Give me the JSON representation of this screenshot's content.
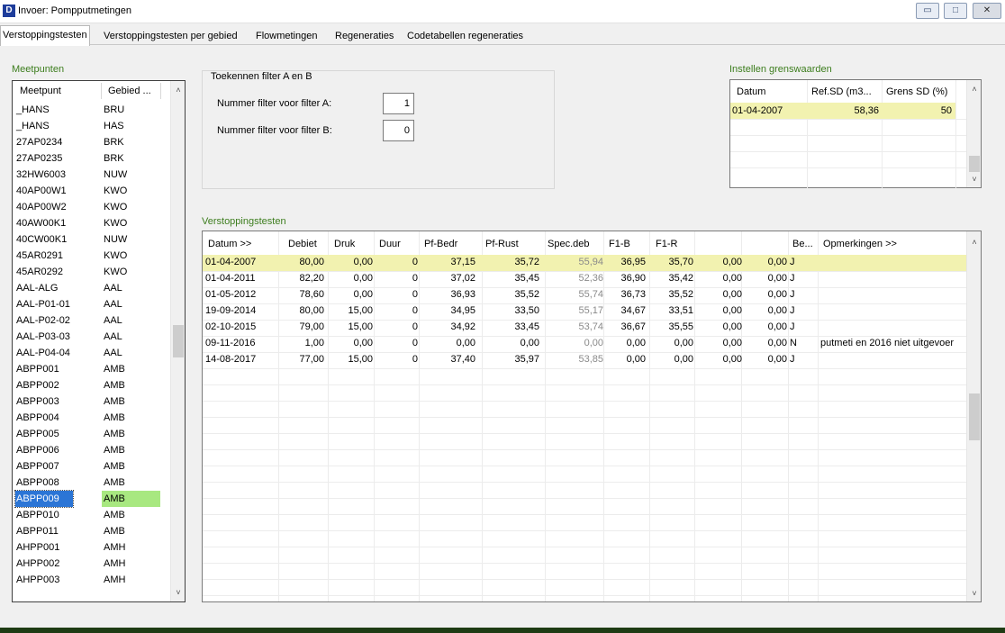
{
  "window": {
    "title": "Invoer: Pompputmetingen",
    "icon_letter": "D",
    "minimize_glyph": "▭",
    "maximize_glyph": "□",
    "close_glyph": "✕"
  },
  "tabs": [
    {
      "label": "Verstoppingstesten",
      "active": true
    },
    {
      "label": "Verstoppingstesten per gebied"
    },
    {
      "label": "Flowmetingen"
    },
    {
      "label": "Regeneraties"
    },
    {
      "label": "Codetabellen regeneraties"
    }
  ],
  "meetpunten": {
    "label": "Meetpunten",
    "columns": [
      "Meetpunt",
      "Gebied ..."
    ],
    "selected_index": 29,
    "rows": [
      [
        "_HANS",
        "BRU"
      ],
      [
        "_HANS",
        "HAS"
      ],
      [
        "27AP0234",
        "BRK"
      ],
      [
        "27AP0235",
        "BRK"
      ],
      [
        "32HW6003",
        "NUW"
      ],
      [
        "40AP00W1",
        "KWO"
      ],
      [
        "40AP00W2",
        "KWO"
      ],
      [
        "40AW00K1",
        "KWO"
      ],
      [
        "40CW00K1",
        "NUW"
      ],
      [
        "45AR0291",
        "KWO"
      ],
      [
        "45AR0292",
        "KWO"
      ],
      [
        "AAL-ALG",
        "AAL"
      ],
      [
        "AAL-P01-01",
        "AAL"
      ],
      [
        "AAL-P02-02",
        "AAL"
      ],
      [
        "AAL-P03-03",
        "AAL"
      ],
      [
        "AAL-P04-04",
        "AAL"
      ],
      [
        "ABPP001",
        "AMB"
      ],
      [
        "ABPP002",
        "AMB"
      ],
      [
        "ABPP003",
        "AMB"
      ],
      [
        "ABPP004",
        "AMB"
      ],
      [
        "ABPP005",
        "AMB"
      ],
      [
        "ABPP006",
        "AMB"
      ],
      [
        "ABPP007",
        "AMB"
      ],
      [
        "ABPP008",
        "AMB"
      ],
      [
        "ABPP009",
        "AMB"
      ],
      [
        "ABPP010",
        "AMB"
      ],
      [
        "ABPP011",
        "AMB"
      ],
      [
        "AHPP001",
        "AMH"
      ],
      [
        "AHPP002",
        "AMH"
      ],
      [
        "AHPP003",
        "AMH"
      ]
    ]
  },
  "filter": {
    "title": "Toekennen filter A en B",
    "label_a": "Nummer filter voor filter A:",
    "value_a": "1",
    "label_b": "Nummer filter voor filter B:",
    "value_b": "0"
  },
  "grenswaarden": {
    "label": "Instellen grenswaarden",
    "columns": [
      "Datum",
      "Ref.SD (m3...",
      "Grens SD (%)"
    ],
    "rows": [
      [
        "01-04-2007",
        "58,36",
        "50"
      ]
    ]
  },
  "tests": {
    "label": "Verstoppingstesten",
    "columns": [
      "Datum >>",
      "Debiet",
      "Druk",
      "Duur",
      "Pf-Bedr",
      "Pf-Rust",
      "Spec.deb",
      "F1-B",
      "F1-R",
      "",
      "",
      "Be...",
      "Opmerkingen >>"
    ],
    "rows": [
      [
        "01-04-2007",
        "80,00",
        "0,00",
        "0",
        "37,15",
        "35,72",
        "55,94",
        "36,95",
        "35,70",
        "0,00",
        "0,00",
        "J",
        ""
      ],
      [
        "01-04-2011",
        "82,20",
        "0,00",
        "0",
        "37,02",
        "35,45",
        "52,36",
        "36,90",
        "35,42",
        "0,00",
        "0,00",
        "J",
        ""
      ],
      [
        "01-05-2012",
        "78,60",
        "0,00",
        "0",
        "36,93",
        "35,52",
        "55,74",
        "36,73",
        "35,52",
        "0,00",
        "0,00",
        "J",
        ""
      ],
      [
        "19-09-2014",
        "80,00",
        "15,00",
        "0",
        "34,95",
        "33,50",
        "55,17",
        "34,67",
        "33,51",
        "0,00",
        "0,00",
        "J",
        ""
      ],
      [
        "02-10-2015",
        "79,00",
        "15,00",
        "0",
        "34,92",
        "33,45",
        "53,74",
        "36,67",
        "35,55",
        "0,00",
        "0,00",
        "J",
        ""
      ],
      [
        "09-11-2016",
        "1,00",
        "0,00",
        "0",
        "0,00",
        "0,00",
        "0,00",
        "0,00",
        "0,00",
        "0,00",
        "0,00",
        "N",
        "putmeti en 2016 niet uitgevoer"
      ],
      [
        "14-08-2017",
        "77,00",
        "15,00",
        "0",
        "37,40",
        "35,97",
        "53,85",
        "0,00",
        "0,00",
        "0,00",
        "0,00",
        "J",
        ""
      ]
    ]
  },
  "scroll": {
    "up": "˄",
    "down": "˅"
  }
}
